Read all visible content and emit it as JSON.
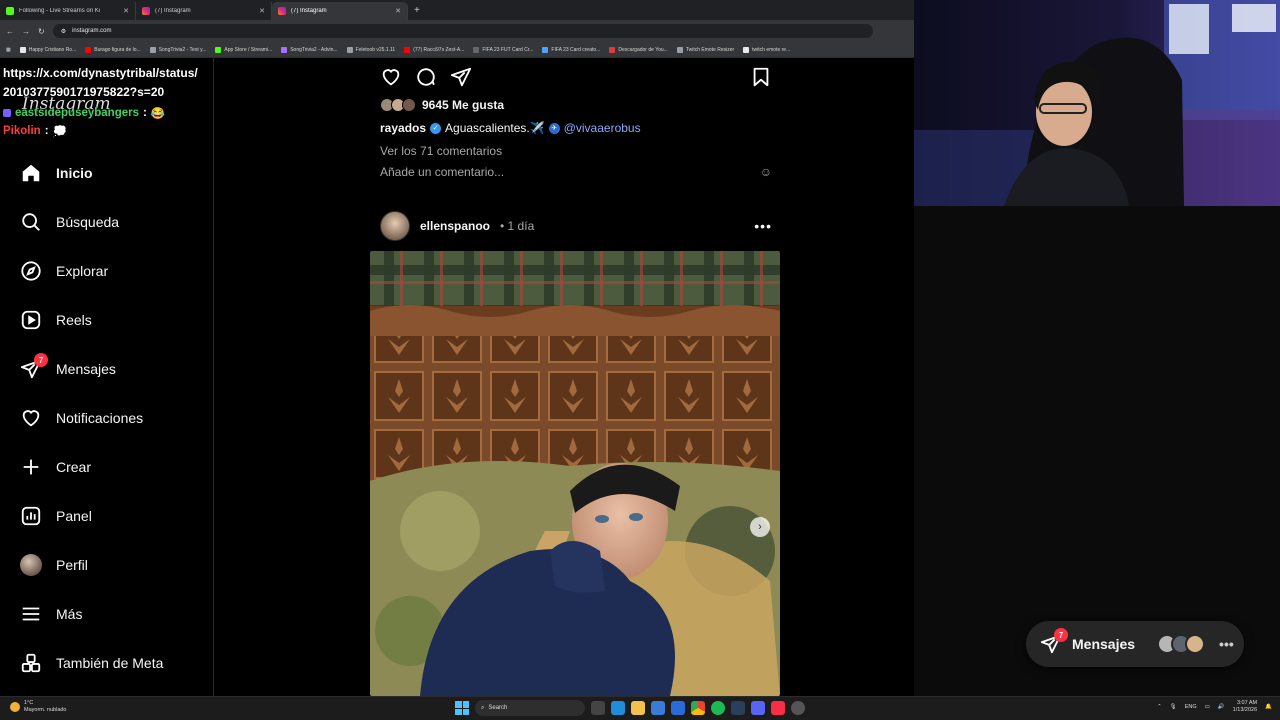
{
  "browser": {
    "tabs": [
      {
        "title": "Following - Live Streams on Ki",
        "active": false,
        "favicon_color": "#53fc18"
      },
      {
        "title": "(7) Instagram",
        "active": false,
        "favicon_color": "#e1306c"
      },
      {
        "title": "(7) Instagram",
        "active": true,
        "favicon_color": "#e1306c"
      }
    ],
    "new_tab": "+",
    "url": "instagram.com",
    "bookmarks": [
      {
        "label": "Happy Cristiano Ro...",
        "color": "#e8e8e8"
      },
      {
        "label": "Burago figura de lo...",
        "color": "#ff0000"
      },
      {
        "label": "SongTrivia2 - Test y...",
        "color": "#9aa0a6"
      },
      {
        "label": "App Store / Streami...",
        "color": "#53fc18"
      },
      {
        "label": "SongTrivia2 - Advin...",
        "color": "#a970ff"
      },
      {
        "label": "Feletoob v25.1.11",
        "color": "#9aa0a6"
      },
      {
        "label": "(77) Racci97s Zest-A...",
        "color": "#ff0000"
      },
      {
        "label": "FIFA 23 FUT Card Cr...",
        "color": "#444444"
      },
      {
        "label": "FIFA 23 Card creato...",
        "color": "#4fa3ff"
      },
      {
        "label": "Descargador de You...",
        "color": "#e03b3b"
      },
      {
        "label": "Twitch Emote Resizer",
        "color": "#9aa0a6"
      },
      {
        "label": "twitch emote re...",
        "color": "#e8e8e8"
      }
    ]
  },
  "chat_overlay": {
    "url_line1": "https://x.com/dynastytribal/status/",
    "url_line2": "2010377590171975822?s=20",
    "msg1_user": "eastsidepuseybangers",
    "msg1_sep": ":",
    "msg1_emote": "😂",
    "msg2_user": "Pikolin",
    "msg2_sep": ":",
    "msg2_emote": "💭"
  },
  "sidebar": {
    "logo": "Instagram",
    "items": [
      {
        "label": "Inicio",
        "icon": "home-icon"
      },
      {
        "label": "Búsqueda",
        "icon": "search-icon"
      },
      {
        "label": "Explorar",
        "icon": "compass-icon"
      },
      {
        "label": "Reels",
        "icon": "reels-icon"
      },
      {
        "label": "Mensajes",
        "icon": "messenger-icon",
        "badge": "7"
      },
      {
        "label": "Notificaciones",
        "icon": "heart-icon"
      },
      {
        "label": "Crear",
        "icon": "plus-icon"
      },
      {
        "label": "Panel",
        "icon": "dashboard-icon"
      },
      {
        "label": "Perfil",
        "icon": "avatar"
      },
      {
        "label": "Más",
        "icon": "menu-icon"
      },
      {
        "label": "También de Meta",
        "icon": "meta-apps-icon"
      }
    ]
  },
  "feed": {
    "prev_post": {
      "likes": "9645 Me gusta",
      "caption_user": "rayados",
      "caption_text": "Aguascalientes.✈️",
      "caption_mention": "@vivaaerobus",
      "view_comments": "Ver los 71 comentarios",
      "add_comment_placeholder": "Añade un comentario..."
    },
    "post": {
      "username": "ellenspanoo",
      "time": "• 1 día",
      "more": "•••"
    }
  },
  "messages_pill": {
    "label": "Mensajes",
    "badge": "7",
    "more": "•••"
  },
  "taskbar": {
    "weather_temp": "1°C",
    "weather_desc": "Mayorm. nublado",
    "search": "Search",
    "lang": "ENG",
    "time": "3:07 AM",
    "date": "1/13/2026"
  },
  "colors": {
    "accent_blue": "#0095f6",
    "badge_red": "#ff3040",
    "mention_blue": "#8ba7ff"
  }
}
